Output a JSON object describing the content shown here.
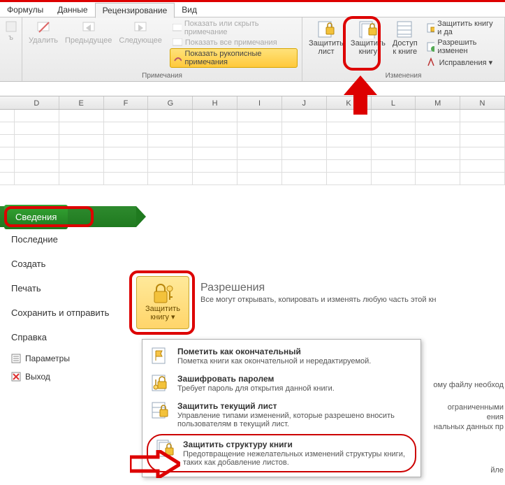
{
  "tabs": {
    "formulas": "Формулы",
    "data": "Данные",
    "review": "Рецензирование",
    "view": "Вид"
  },
  "ribbon": {
    "delete": "Удалить",
    "prev": "Предыдущее",
    "next": "Следующее",
    "show_hide_note": "Показать или скрыть примечание",
    "show_all_notes": "Показать все примечания",
    "show_ink": "Показать рукописные примечания",
    "protect_sheet_l1": "Защитить",
    "protect_sheet_l2": "лист",
    "protect_book_l1": "Защитить",
    "protect_book_l2": "книгу",
    "access_l1": "Доступ",
    "access_l2": "к книге",
    "protect_share": "Защитить книгу и да",
    "allow_changes": "Разрешить изменен",
    "corrections": "Исправления ▾",
    "grp_notes": "Примечания",
    "grp_changes": "Изменения"
  },
  "cols": [
    "D",
    "E",
    "F",
    "G",
    "H",
    "I",
    "J",
    "K",
    "L",
    "M",
    "N"
  ],
  "backstage": {
    "info": "Сведения",
    "recent": "Последние",
    "new": "Создать",
    "print": "Печать",
    "save_send": "Сохранить и отправить",
    "help": "Справка",
    "options": "Параметры",
    "exit": "Выход"
  },
  "perm": {
    "title": "Разрешения",
    "sub": "Все могут открывать, копировать и изменять любую часть этой кн",
    "btn_l1": "Защитить",
    "btn_l2": "книгу ▾"
  },
  "menu": {
    "final_t": "Пометить как окончательный",
    "final_d": "Пометка книги как окончательной и нередактируемой.",
    "encrypt_t": "Зашифровать паролем",
    "encrypt_d": "Требует пароль для открытия данной книги.",
    "sheet_t": "Защитить текущий лист",
    "sheet_d": "Управление типами изменений, которые разрешено вносить пользователям в текущий лист.",
    "struct_t": "Защитить структуру книги",
    "struct_d": "Предотвращение нежелательных изменений структуры книги, таких как добавление листов."
  },
  "side": {
    "l1": "ому файлу необход",
    "l2": "ограниченными",
    "l3": "ения",
    "l4": "нальных данных пр",
    "l5": "йле"
  }
}
